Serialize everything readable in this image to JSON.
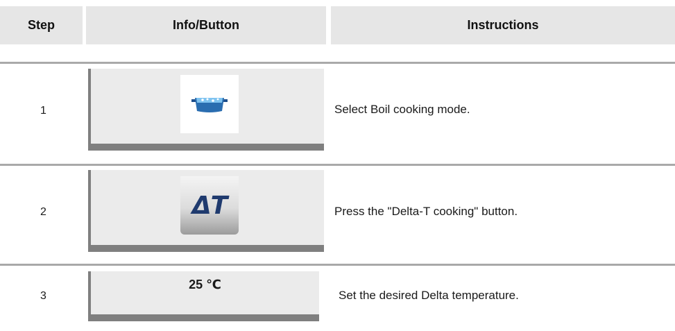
{
  "table": {
    "headers": {
      "step": "Step",
      "info_button": "Info/Button",
      "instructions": "Instructions"
    },
    "rows": [
      {
        "step": "1",
        "icon": "boil-pot-icon",
        "instruction": "Select Boil cooking mode."
      },
      {
        "step": "2",
        "icon": "delta-t-icon",
        "button_text": "ΔT",
        "instruction": "Press the \"Delta-T cooking\" button."
      },
      {
        "step": "3",
        "display_value": "25 ℃",
        "instruction": "Set the desired Delta temperature."
      }
    ]
  },
  "colors": {
    "header_bg": "#e6e6e6",
    "panel_bg": "#ebebeb",
    "panel_edge": "#7f7f7f",
    "rule": "#a9a9a9",
    "pot_blue": "#2a6db0",
    "delta_t_blue": "#1f3a6e"
  }
}
